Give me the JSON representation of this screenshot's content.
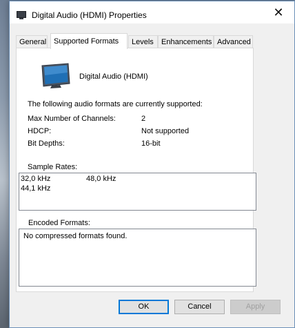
{
  "window": {
    "title": "Digital Audio (HDMI) Properties",
    "close_glyph": "✕",
    "accent_border": "#6a8fb8"
  },
  "tabs": [
    {
      "label": "General",
      "active": false
    },
    {
      "label": "Supported Formats",
      "active": true
    },
    {
      "label": "Levels",
      "active": false
    },
    {
      "label": "Enhancements",
      "active": false
    },
    {
      "label": "Advanced",
      "active": false
    }
  ],
  "device": {
    "icon": "monitor-icon",
    "name": "Digital Audio (HDMI)"
  },
  "formats": {
    "summary": "The following audio formats are currently supported:",
    "properties": [
      {
        "label": "Max Number of Channels:",
        "value": "2"
      },
      {
        "label": "HDCP:",
        "value": "Not supported"
      },
      {
        "label": "Bit Depths:",
        "value": "16-bit"
      }
    ],
    "sample_rates_label": "Sample Rates:",
    "sample_rates": [
      "32,0 kHz",
      "48,0 kHz",
      "44,1 kHz"
    ],
    "encoded_formats_label": "Encoded Formats:",
    "encoded_formats_text": "No compressed formats found."
  },
  "buttons": {
    "ok": "OK",
    "cancel": "Cancel",
    "apply": "Apply"
  }
}
